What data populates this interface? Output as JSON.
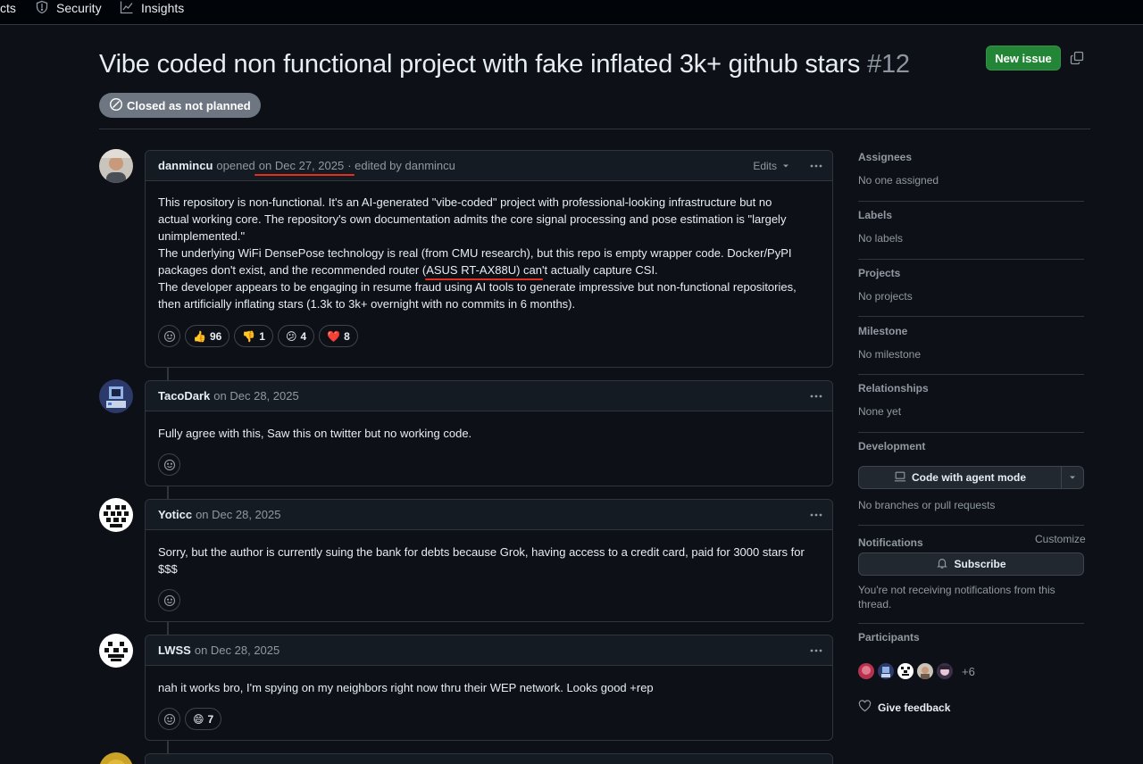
{
  "nav": {
    "projects_partial": "cts",
    "security": "Security",
    "insights": "Insights"
  },
  "issue": {
    "title": "Vibe coded non functional project with fake inflated 3k+ github stars",
    "number": "#12",
    "new_issue_label": "New issue",
    "state": "Closed as not planned"
  },
  "comments": [
    {
      "author": "danmincu",
      "action": "opened",
      "date": "on Dec 27, 2025",
      "edited": "· edited by danmincu",
      "edits_label": "Edits",
      "body_lines": [
        "This repository is non-functional. It's an AI-generated \"vibe-coded\" project with professional-looking infrastructure but no",
        "actual working core. The repository's own documentation admits the core signal processing and pose estimation is \"largely",
        "unimplemented.\"",
        "The underlying WiFi DensePose technology is real (from CMU research), but this repo is empty wrapper code. Docker/PyPI",
        "packages don't exist, and the recommended router (ASUS RT-AX88U) can't actually capture CSI.",
        "The developer appears to be engaging in resume fraud using AI tools to generate impressive but non-functional repositories,",
        "then artificially inflating stars (1.3k to 3k+ overnight with no commits in 6 months)."
      ],
      "reactions": [
        {
          "emoji": "👍",
          "count": "96"
        },
        {
          "emoji": "👎",
          "count": "1"
        },
        {
          "emoji": "😕",
          "count": "4"
        },
        {
          "emoji": "❤️",
          "count": "8"
        }
      ]
    },
    {
      "author": "TacoDark",
      "date": "on Dec 28, 2025",
      "body": "Fully agree with this, Saw this on twitter but no working code."
    },
    {
      "author": "Yoticc",
      "date": "on Dec 28, 2025",
      "body_lines": [
        "Sorry, but the author is currently suing the bank for debts because Grok, having access to a credit card, paid for 3000 stars for",
        "$$$"
      ]
    },
    {
      "author": "LWSS",
      "date": "on Dec 28, 2025",
      "body": "nah it works bro, I'm spying on my neighbors right now thru their WEP network. Looks good +rep",
      "reactions": [
        {
          "emoji": "😄",
          "count": "7"
        }
      ]
    }
  ],
  "sidebar": {
    "assignees": {
      "label": "Assignees",
      "value": "No one assigned"
    },
    "labels": {
      "label": "Labels",
      "value": "No labels"
    },
    "projects": {
      "label": "Projects",
      "value": "No projects"
    },
    "milestone": {
      "label": "Milestone",
      "value": "No milestone"
    },
    "relationships": {
      "label": "Relationships",
      "value": "None yet"
    },
    "development": {
      "label": "Development",
      "button": "Code with agent mode",
      "value": "No branches or pull requests"
    },
    "notifications": {
      "label": "Notifications",
      "customize": "Customize",
      "subscribe": "Subscribe",
      "note_line1": "You're not receiving notifications from this",
      "note_line2": "thread."
    },
    "participants": {
      "label": "Participants",
      "more": "+6"
    },
    "feedback": "Give feedback"
  }
}
